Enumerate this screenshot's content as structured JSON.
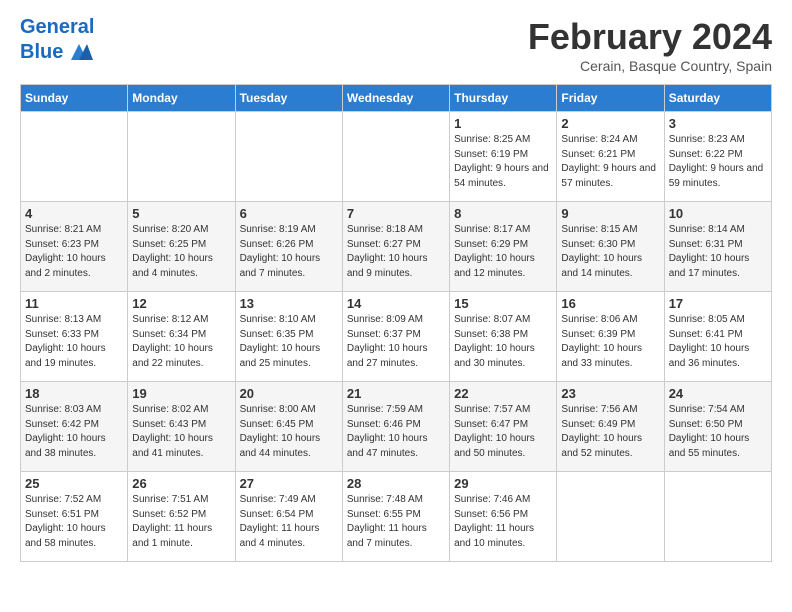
{
  "header": {
    "logo_line1": "General",
    "logo_line2": "Blue",
    "month_title": "February 2024",
    "location": "Cerain, Basque Country, Spain"
  },
  "days_of_week": [
    "Sunday",
    "Monday",
    "Tuesday",
    "Wednesday",
    "Thursday",
    "Friday",
    "Saturday"
  ],
  "weeks": [
    [
      {
        "day": "",
        "empty": true
      },
      {
        "day": "",
        "empty": true
      },
      {
        "day": "",
        "empty": true
      },
      {
        "day": "",
        "empty": true
      },
      {
        "day": "1",
        "sunrise": "8:25 AM",
        "sunset": "6:19 PM",
        "daylight": "9 hours and 54 minutes."
      },
      {
        "day": "2",
        "sunrise": "8:24 AM",
        "sunset": "6:21 PM",
        "daylight": "9 hours and 57 minutes."
      },
      {
        "day": "3",
        "sunrise": "8:23 AM",
        "sunset": "6:22 PM",
        "daylight": "9 hours and 59 minutes."
      }
    ],
    [
      {
        "day": "4",
        "sunrise": "8:21 AM",
        "sunset": "6:23 PM",
        "daylight": "10 hours and 2 minutes."
      },
      {
        "day": "5",
        "sunrise": "8:20 AM",
        "sunset": "6:25 PM",
        "daylight": "10 hours and 4 minutes."
      },
      {
        "day": "6",
        "sunrise": "8:19 AM",
        "sunset": "6:26 PM",
        "daylight": "10 hours and 7 minutes."
      },
      {
        "day": "7",
        "sunrise": "8:18 AM",
        "sunset": "6:27 PM",
        "daylight": "10 hours and 9 minutes."
      },
      {
        "day": "8",
        "sunrise": "8:17 AM",
        "sunset": "6:29 PM",
        "daylight": "10 hours and 12 minutes."
      },
      {
        "day": "9",
        "sunrise": "8:15 AM",
        "sunset": "6:30 PM",
        "daylight": "10 hours and 14 minutes."
      },
      {
        "day": "10",
        "sunrise": "8:14 AM",
        "sunset": "6:31 PM",
        "daylight": "10 hours and 17 minutes."
      }
    ],
    [
      {
        "day": "11",
        "sunrise": "8:13 AM",
        "sunset": "6:33 PM",
        "daylight": "10 hours and 19 minutes."
      },
      {
        "day": "12",
        "sunrise": "8:12 AM",
        "sunset": "6:34 PM",
        "daylight": "10 hours and 22 minutes."
      },
      {
        "day": "13",
        "sunrise": "8:10 AM",
        "sunset": "6:35 PM",
        "daylight": "10 hours and 25 minutes."
      },
      {
        "day": "14",
        "sunrise": "8:09 AM",
        "sunset": "6:37 PM",
        "daylight": "10 hours and 27 minutes."
      },
      {
        "day": "15",
        "sunrise": "8:07 AM",
        "sunset": "6:38 PM",
        "daylight": "10 hours and 30 minutes."
      },
      {
        "day": "16",
        "sunrise": "8:06 AM",
        "sunset": "6:39 PM",
        "daylight": "10 hours and 33 minutes."
      },
      {
        "day": "17",
        "sunrise": "8:05 AM",
        "sunset": "6:41 PM",
        "daylight": "10 hours and 36 minutes."
      }
    ],
    [
      {
        "day": "18",
        "sunrise": "8:03 AM",
        "sunset": "6:42 PM",
        "daylight": "10 hours and 38 minutes."
      },
      {
        "day": "19",
        "sunrise": "8:02 AM",
        "sunset": "6:43 PM",
        "daylight": "10 hours and 41 minutes."
      },
      {
        "day": "20",
        "sunrise": "8:00 AM",
        "sunset": "6:45 PM",
        "daylight": "10 hours and 44 minutes."
      },
      {
        "day": "21",
        "sunrise": "7:59 AM",
        "sunset": "6:46 PM",
        "daylight": "10 hours and 47 minutes."
      },
      {
        "day": "22",
        "sunrise": "7:57 AM",
        "sunset": "6:47 PM",
        "daylight": "10 hours and 50 minutes."
      },
      {
        "day": "23",
        "sunrise": "7:56 AM",
        "sunset": "6:49 PM",
        "daylight": "10 hours and 52 minutes."
      },
      {
        "day": "24",
        "sunrise": "7:54 AM",
        "sunset": "6:50 PM",
        "daylight": "10 hours and 55 minutes."
      }
    ],
    [
      {
        "day": "25",
        "sunrise": "7:52 AM",
        "sunset": "6:51 PM",
        "daylight": "10 hours and 58 minutes."
      },
      {
        "day": "26",
        "sunrise": "7:51 AM",
        "sunset": "6:52 PM",
        "daylight": "11 hours and 1 minute."
      },
      {
        "day": "27",
        "sunrise": "7:49 AM",
        "sunset": "6:54 PM",
        "daylight": "11 hours and 4 minutes."
      },
      {
        "day": "28",
        "sunrise": "7:48 AM",
        "sunset": "6:55 PM",
        "daylight": "11 hours and 7 minutes."
      },
      {
        "day": "29",
        "sunrise": "7:46 AM",
        "sunset": "6:56 PM",
        "daylight": "11 hours and 10 minutes."
      },
      {
        "day": "",
        "empty": true
      },
      {
        "day": "",
        "empty": true
      }
    ]
  ]
}
